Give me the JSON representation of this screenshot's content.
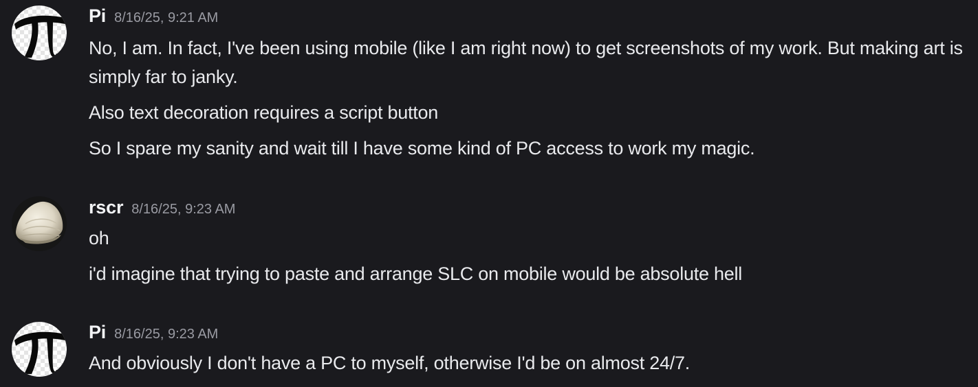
{
  "messages": [
    {
      "user": "Pi",
      "timestamp": "8/16/25, 9:21 AM",
      "avatar": "pi-symbol-avatar",
      "lines": [
        "No, I am. In fact, I've been using mobile (like I am right now) to get screenshots of my work. But making art is simply far to janky.",
        "Also text decoration requires a script button",
        "So I spare my sanity and wait till I have some kind of PC access to work my magic."
      ]
    },
    {
      "user": "rscr",
      "timestamp": "8/16/25, 9:23 AM",
      "avatar": "seashell-avatar",
      "lines": [
        "oh",
        "i'd imagine that trying to paste and arrange SLC on mobile would be absolute hell"
      ]
    },
    {
      "user": "Pi",
      "timestamp": "8/16/25, 9:23 AM",
      "avatar": "pi-symbol-avatar",
      "lines": [
        "And obviously I don't have a PC to myself, otherwise I'd be on almost 24/7."
      ]
    }
  ],
  "colors": {
    "background": "#1a1a1e",
    "username": "#f2f3f5",
    "timestamp": "#9a9ba3",
    "text": "#e9eaed"
  }
}
